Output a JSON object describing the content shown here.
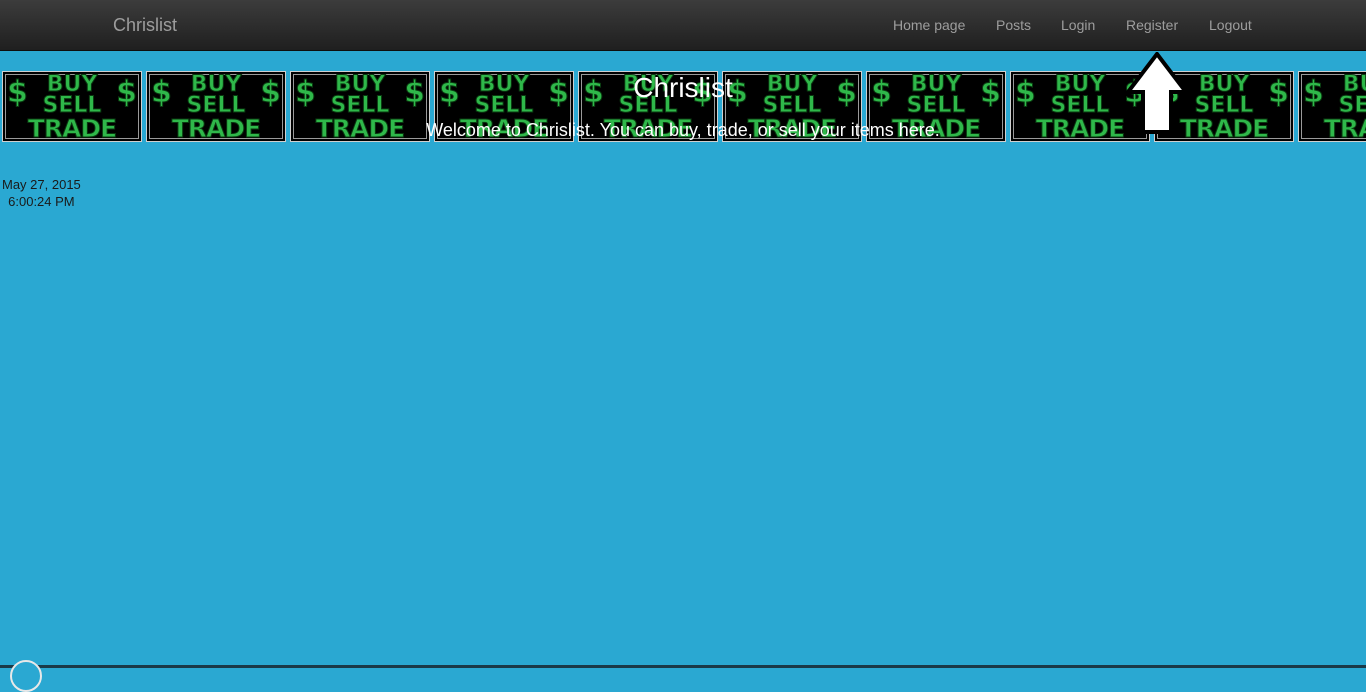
{
  "nav": {
    "brand": "Chrislist",
    "links": [
      "Home page",
      "Posts",
      "Login",
      "Register",
      "Logout"
    ]
  },
  "banner": {
    "tile": {
      "dollar": "$",
      "line1": "BUY",
      "line2": "SELL",
      "line3": "TRADE"
    },
    "tile_count": 10,
    "colors": {
      "green": "#2fb84a",
      "black": "#000000"
    }
  },
  "hero": {
    "title": "Chrislist",
    "subtitle": "Welcome to Chrislist. You can buy, trade, or sell your items here."
  },
  "clock": {
    "date": "May 27, 2015",
    "time": "6:00:24 PM"
  },
  "icons": {
    "annotation": "up-arrow-icon"
  },
  "colors": {
    "background": "#2aa8d2",
    "navbar": "#2b2b2b",
    "nav_text": "#9d9d9d",
    "hero_text": "#ffffff"
  }
}
